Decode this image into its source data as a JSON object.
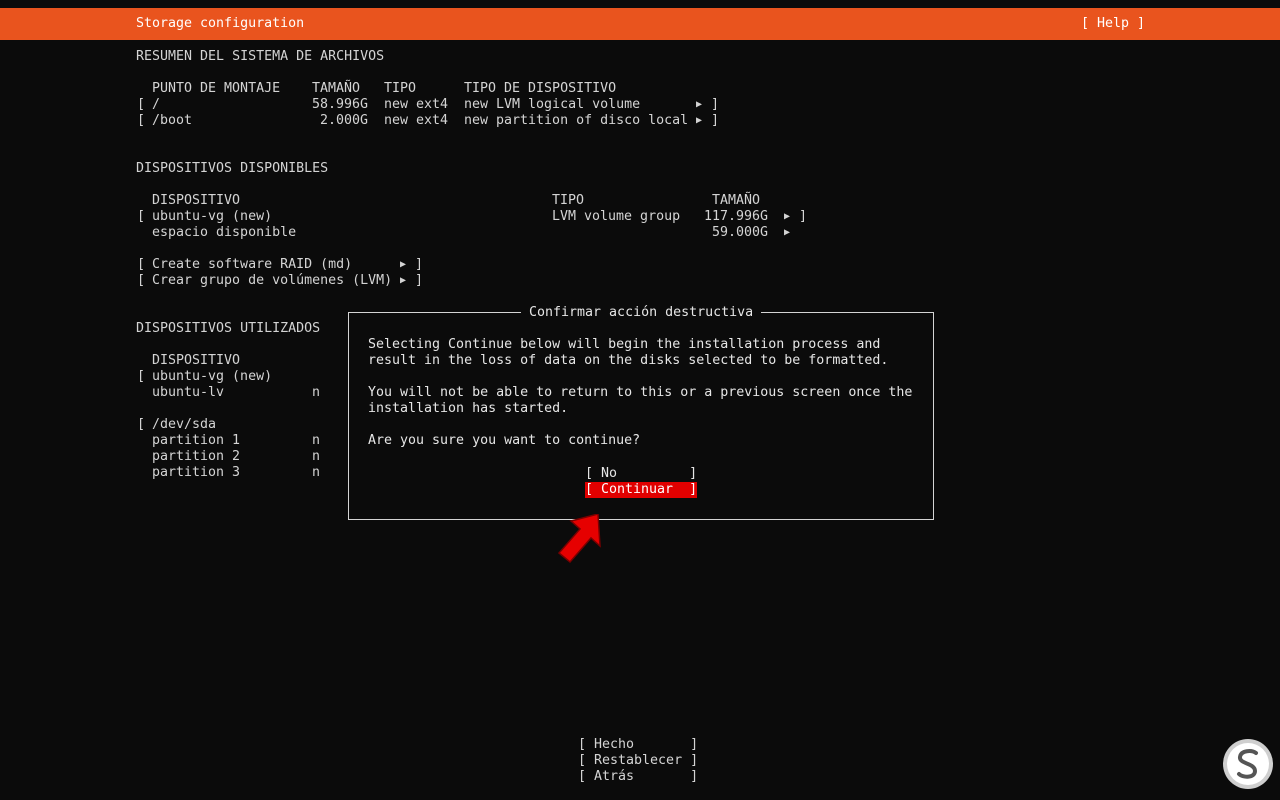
{
  "header": {
    "title": "Storage configuration",
    "help": "[ Help ]"
  },
  "summary": {
    "title": "RESUMEN DEL SISTEMA DE ARCHIVOS",
    "columns": [
      "PUNTO DE MONTAJE",
      "TAMAÑO",
      "TIPO",
      "TIPO DE DISPOSITIVO"
    ],
    "rows": [
      {
        "mount": "/",
        "size": "58.996G",
        "type": "new ext4",
        "device": "new LVM logical volume"
      },
      {
        "mount": "/boot",
        "size": "2.000G",
        "type": "new ext4",
        "device": "new partition of disco local"
      }
    ]
  },
  "available": {
    "title": "DISPOSITIVOS DISPONIBLES",
    "columns": [
      "DISPOSITIVO",
      "TIPO",
      "TAMAÑO"
    ],
    "rows": [
      {
        "device": "ubuntu-vg (new)",
        "type": "LVM volume group",
        "size": "117.996G"
      },
      {
        "device": "espacio disponible",
        "type": "",
        "size": "59.000G"
      }
    ],
    "actions": [
      "Create software RAID (md)",
      "Crear grupo de volúmenes (LVM)"
    ]
  },
  "used": {
    "title": "DISPOSITIVOS UTILIZADOS",
    "column": "DISPOSITIVO",
    "rows": [
      "ubuntu-vg (new)",
      "ubuntu-lv",
      "/dev/sda",
      "partition 1",
      "partition 2",
      "partition 3"
    ],
    "partial": "n"
  },
  "dialog": {
    "title": "Confirmar acción destructiva",
    "line1": "Selecting Continue below will begin the installation process and",
    "line2": "result in the loss of data on the disks selected to be formatted.",
    "line3": "You will not be able to return to this or a previous screen once the",
    "line4": "installation has started.",
    "question": "Are you sure you want to continue?",
    "no": "[ No         ]",
    "continue": "[ Continuar  ]"
  },
  "footer": {
    "done": "[ Hecho       ]",
    "reset": "[ Restablecer ]",
    "back": "[ Atrás       ]"
  },
  "colors": {
    "accent": "#e9541e",
    "selected": "#e10000",
    "background": "#0b0b0b",
    "text": "#d4d4d4"
  }
}
